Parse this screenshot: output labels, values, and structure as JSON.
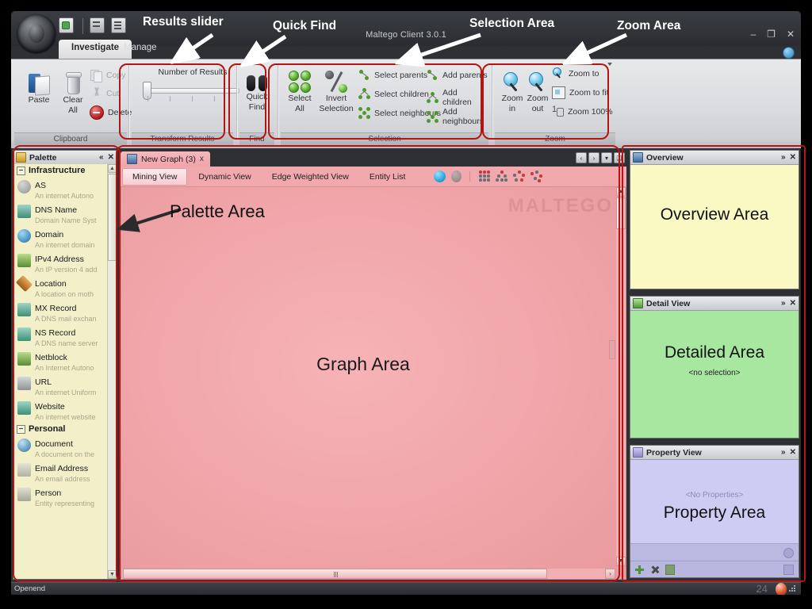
{
  "app": {
    "title": "Maltego Client 3.0.1",
    "window_buttons": [
      "–",
      "❐",
      "✕"
    ],
    "quick_access": [
      "new-graph-icon",
      "save-icon",
      "save-all-icon"
    ]
  },
  "ribbon": {
    "tabs": [
      {
        "label": "Investigate",
        "active": true
      },
      {
        "label": "Manage",
        "active": false
      }
    ],
    "groups": [
      {
        "name": "Clipboard",
        "label": "Clipboard",
        "big_buttons": [
          {
            "label_line1": "Paste",
            "label_line2": "",
            "icon": "paste-icon"
          },
          {
            "label_line1": "Clear",
            "label_line2": "All",
            "icon": "clear-all-icon"
          }
        ],
        "small_items": [
          {
            "label": "Copy",
            "icon": "copy-icon",
            "disabled": true
          },
          {
            "label": "Cut",
            "icon": "cut-icon",
            "disabled": true
          },
          {
            "label": "Delete",
            "icon": "delete-icon",
            "disabled": false
          }
        ]
      },
      {
        "name": "Transform Results",
        "label": "Transform Results",
        "slider_title": "Number of Results",
        "slider_value": 0
      },
      {
        "name": "Find",
        "label": "Find",
        "big_buttons": [
          {
            "label_line1": "Quick",
            "label_line2": "Find",
            "icon": "binoculars-icon"
          }
        ]
      },
      {
        "name": "Selection",
        "label": "Selection",
        "big_buttons": [
          {
            "label_line1": "Select",
            "label_line2": "All",
            "icon": "select-all-icon"
          },
          {
            "label_line1": "Invert",
            "label_line2": "Selection",
            "icon": "invert-selection-icon"
          }
        ],
        "small_items_col1": [
          {
            "label": "Select parents",
            "icon": "select-parents-icon"
          },
          {
            "label": "Select children",
            "icon": "select-children-icon"
          },
          {
            "label": "Select neighbours",
            "icon": "select-neighbours-icon"
          }
        ],
        "small_items_col2": [
          {
            "label": "Add parents",
            "icon": "add-parents-icon"
          },
          {
            "label": "Add children",
            "icon": "add-children-icon"
          },
          {
            "label": "Add neighbours",
            "icon": "add-neighbours-icon"
          }
        ]
      },
      {
        "name": "Zoom",
        "label": "Zoom",
        "big_buttons": [
          {
            "label_line1": "Zoom",
            "label_line2": "in",
            "icon": "zoom-in-icon"
          },
          {
            "label_line1": "Zoom",
            "label_line2": "out",
            "icon": "zoom-out-icon"
          }
        ],
        "small_items": [
          {
            "label": "Zoom to",
            "icon": "zoom-to-icon"
          },
          {
            "label": "Zoom to fit",
            "icon": "zoom-to-fit-icon"
          },
          {
            "label": "Zoom 100%",
            "icon": "zoom-100-icon"
          }
        ]
      }
    ]
  },
  "palette": {
    "title": "Palette",
    "collapse_label": "«",
    "close_label": "✕",
    "groups": [
      {
        "name": "Infrastructure",
        "entries": [
          {
            "name": "AS",
            "desc": "An internet Autono",
            "color": "gray"
          },
          {
            "name": "DNS Name",
            "desc": "Domain Name Syst",
            "color": "teal"
          },
          {
            "name": "Domain",
            "desc": "An internet domain",
            "color": "blue"
          },
          {
            "name": "IPv4 Address",
            "desc": "An IP version 4 add",
            "color": "green"
          },
          {
            "name": "Location",
            "desc": "A location on moth",
            "color": "orange"
          },
          {
            "name": "MX Record",
            "desc": "A DNS mail exchan",
            "color": "teal"
          },
          {
            "name": "NS Record",
            "desc": "A DNS name server",
            "color": "teal"
          },
          {
            "name": "Netblock",
            "desc": "An Internet Autono",
            "color": "green"
          },
          {
            "name": "URL",
            "desc": "An internet Uniform",
            "color": "gray"
          },
          {
            "name": "Website",
            "desc": "An internet website",
            "color": "teal"
          }
        ]
      },
      {
        "name": "Personal",
        "entries": [
          {
            "name": "Document",
            "desc": "A document on the",
            "color": "blue"
          },
          {
            "name": "Email Address",
            "desc": "An email address",
            "color": "gray"
          },
          {
            "name": "Person",
            "desc": "Entity representing",
            "color": "gray"
          }
        ]
      }
    ]
  },
  "graph": {
    "document_tab": "New Graph (3)",
    "document_tab_close": "x",
    "tab_controls": [
      "‹",
      "›",
      "▾",
      "❑"
    ],
    "view_tabs": [
      {
        "label": "Mining View",
        "active": true
      },
      {
        "label": "Dynamic View",
        "active": false
      },
      {
        "label": "Edge Weighted View",
        "active": false
      },
      {
        "label": "Entity List",
        "active": false
      }
    ],
    "layout_icons": [
      "block-layout-icon",
      "hierarchical-layout-icon",
      "circular-layout-icon",
      "organic-layout-icon"
    ],
    "watermark": "MALTEGO",
    "area_label": "Graph Area"
  },
  "right_panels": [
    {
      "key": "overview",
      "title": "Overview",
      "icon": "overview-icon",
      "buttons": [
        "»",
        "✕"
      ],
      "body_label": "Overview Area",
      "bg": "#fbf9c3"
    },
    {
      "key": "detail",
      "title": "Detail View",
      "icon": "detail-view-icon",
      "buttons": [
        "»",
        "✕"
      ],
      "body_label": "Detailed Area",
      "sub_label": "<no selection>",
      "bg": "#a7e7a0"
    },
    {
      "key": "property",
      "title": "Property View",
      "icon": "property-view-icon",
      "buttons": [
        "»",
        "✕"
      ],
      "body_label": "Property Area",
      "sub_label": "<No Properties>",
      "bg": "#cfccf4",
      "toolbar_icons": [
        "add-property-icon",
        "delete-property-icon",
        "copy-property-icon",
        "property-options-icon"
      ]
    }
  ],
  "statusbar": {
    "message": "Openend",
    "counter": "24",
    "indicator": "activity-orb-icon"
  },
  "annotations": [
    {
      "id": "results-slider",
      "text": "Results slider"
    },
    {
      "id": "quick-find",
      "text": "Quick Find"
    },
    {
      "id": "selection-area",
      "text": "Selection Area"
    },
    {
      "id": "zoom-area",
      "text": "Zoom Area"
    },
    {
      "id": "palette-area",
      "text": "Palette Area"
    }
  ],
  "colors": {
    "highlight": "#b41414",
    "overview_bg": "#fbf9c3",
    "detail_bg": "#a7e7a0",
    "property_bg": "#cfccf4",
    "graph_bg": "#f2a9ad"
  }
}
